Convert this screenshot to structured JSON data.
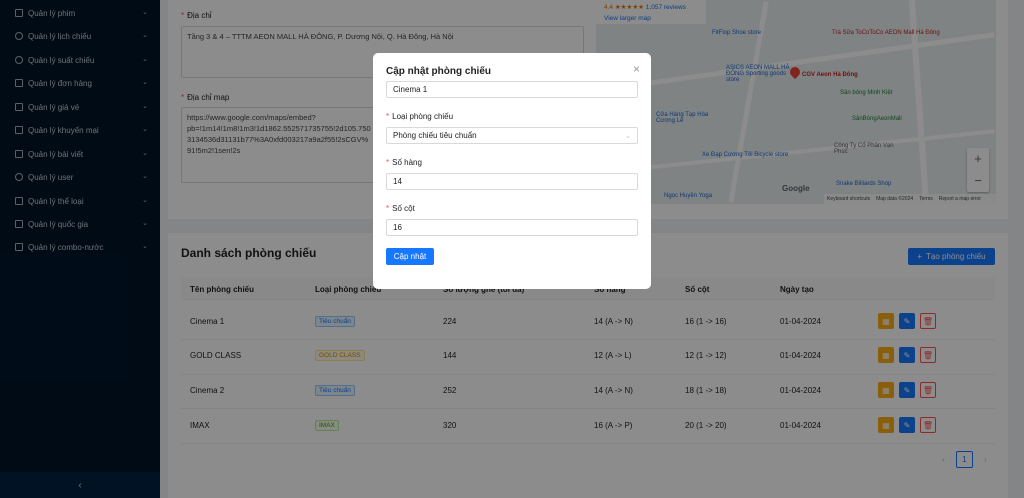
{
  "sidebar": {
    "items": [
      {
        "label": "Quản lý phim",
        "icon": "film-icon"
      },
      {
        "label": "Quản lý lịch chiếu",
        "icon": "calendar-icon"
      },
      {
        "label": "Quản lý suất chiếu",
        "icon": "clock-icon"
      },
      {
        "label": "Quản lý đơn hàng",
        "icon": "cart-icon"
      },
      {
        "label": "Quản lý giá vé",
        "icon": "ticket-icon"
      },
      {
        "label": "Quản lý khuyến mại",
        "icon": "gift-icon"
      },
      {
        "label": "Quản lý bài viết",
        "icon": "article-icon"
      },
      {
        "label": "Quản lý user",
        "icon": "user-icon"
      },
      {
        "label": "Quản lý thể loại",
        "icon": "tag-icon"
      },
      {
        "label": "Quản lý quốc gia",
        "icon": "globe-icon"
      },
      {
        "label": "Quản lý combo-nước",
        "icon": "drink-icon"
      }
    ],
    "collapse": "‹"
  },
  "form": {
    "address_label": "Địa chỉ",
    "address_value": "Tầng 3 & 4 – TTTM AEON MALL HÀ ĐÔNG, P. Dương Nội, Q. Hà Đông, Hà Nội",
    "map_label": "Địa chỉ map",
    "map_value": "https://www.google.com/maps/embed?\npb=!1m14!1m8!1m3!1d1862.552571735755!2d105.750\n3134536d31131b77%3A0xfd003217a9a2f55!2sCGV%\n91!5m2!1sen!2s"
  },
  "map": {
    "rating": "4.4 ★★★★★",
    "reviews": "1,057 reviews",
    "view_larger": "View larger map",
    "places": [
      "Trà Sữa ToCoToCo AEON Mall Hà Đông",
      "FitFlop Shoe store",
      "ASICS AEON MALL HÀ ĐÔNG Sporting goods store",
      "CGV Aeon Hà Đông",
      "Sân bóng Minh Kiệt",
      "SânBóngAeonMall",
      "Cửa Hàng Tạp Hóa Cương Lê",
      "Xe Đạp Cương Tôi Bicycle store",
      "Công Ty Cổ Phần Vạn Phúc",
      "Snake Billiards Shop",
      "Ngọc Huyền Yoga"
    ],
    "footer": [
      "Keyboard shortcuts",
      "Map data ©2024",
      "Terms",
      "Report a map error"
    ],
    "google": "Google"
  },
  "table": {
    "title": "Danh sách phòng chiếu",
    "create_button": "Tạo phòng chiếu",
    "columns": [
      "Tên phòng chiếu",
      "Loại phòng chiếu",
      "Số lượng ghế (tối đa)",
      "Số hàng",
      "Số cột",
      "Ngày tạo"
    ],
    "rows": [
      {
        "name": "Cinema 1",
        "type": "Tiêu chuẩn",
        "type_color": "blue",
        "seats": "224",
        "rows": "14 (A -> N)",
        "cols": "16 (1 -> 16)",
        "date": "01-04-2024"
      },
      {
        "name": "GOLD CLASS",
        "type": "GOLD CLASS",
        "type_color": "gold",
        "seats": "144",
        "rows": "12 (A -> L)",
        "cols": "12 (1 -> 12)",
        "date": "01-04-2024"
      },
      {
        "name": "Cinema 2",
        "type": "Tiêu chuẩn",
        "type_color": "blue",
        "seats": "252",
        "rows": "14 (A -> N)",
        "cols": "18 (1 -> 18)",
        "date": "01-04-2024"
      },
      {
        "name": "IMAX",
        "type": "IMAX",
        "type_color": "green",
        "seats": "320",
        "rows": "16 (A -> P)",
        "cols": "20 (1 -> 20)",
        "date": "01-04-2024"
      }
    ],
    "pagination": {
      "prev": "‹",
      "current": "1",
      "next": "›"
    }
  },
  "modal": {
    "title": "Cập nhật phòng chiếu",
    "name_value": "Cinema 1",
    "type_label": "Loại phòng chiếu",
    "type_value": "Phòng chiếu tiêu chuẩn",
    "rows_label": "Số hàng",
    "rows_value": "14",
    "cols_label": "Số cột",
    "cols_value": "16",
    "submit": "Cập nhật",
    "close": "×"
  },
  "colors": {
    "primary": "#1677ff",
    "sidebar": "#001529",
    "danger": "#ff4d4f",
    "warning": "#faad14"
  }
}
